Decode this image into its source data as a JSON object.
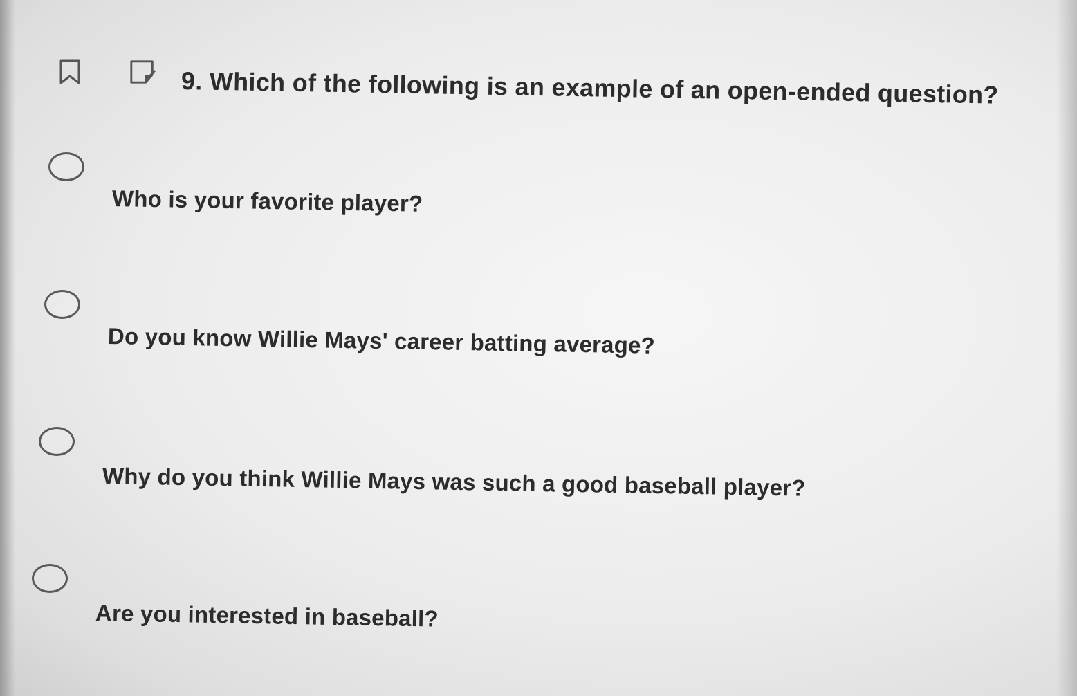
{
  "question": {
    "text": "9. Which of the following is an example of an open-ended question?",
    "icons": {
      "bookmark": "bookmark-icon",
      "note": "note-icon"
    }
  },
  "options": [
    {
      "label": "Who is your favorite player?",
      "selected": false
    },
    {
      "label": "Do you know Willie Mays' career batting average?",
      "selected": false
    },
    {
      "label": "Why do you think Willie Mays was such a good baseball player?",
      "selected": false
    },
    {
      "label": "Are you interested in baseball?",
      "selected": false
    }
  ]
}
